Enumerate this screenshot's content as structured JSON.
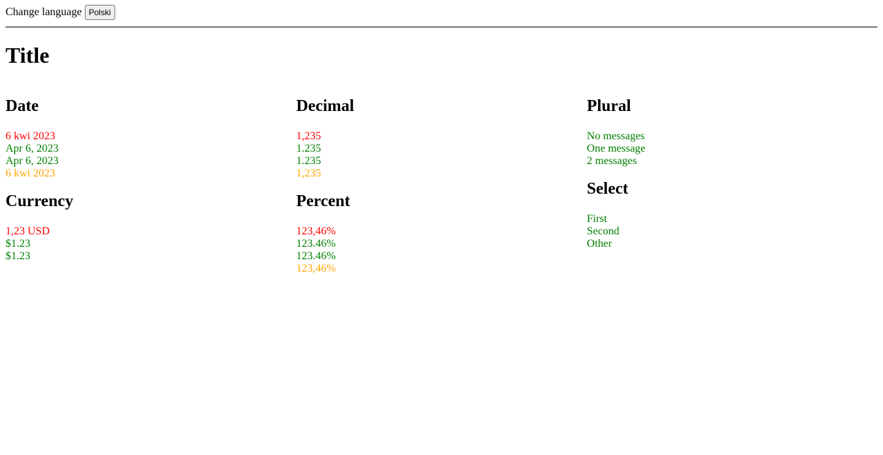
{
  "header": {
    "change_language_label": "Change language",
    "language_button_label": "Polski"
  },
  "page_title": "Title",
  "colors": {
    "red": "#ff0000",
    "green": "#008000",
    "orange": "#ffa500"
  },
  "sections": {
    "date": {
      "title": "Date",
      "values": [
        "6 kwi 2023",
        "Apr 6, 2023",
        "Apr 6, 2023",
        "6 kwi 2023"
      ],
      "colors": [
        "red",
        "green",
        "green",
        "orange"
      ]
    },
    "currency": {
      "title": "Currency",
      "values": [
        "1,23 USD",
        "$1.23",
        "$1.23"
      ],
      "colors": [
        "red",
        "green",
        "green"
      ]
    },
    "decimal": {
      "title": "Decimal",
      "values": [
        "1,235",
        "1.235",
        "1.235",
        "1,235"
      ],
      "colors": [
        "red",
        "green",
        "green",
        "orange"
      ]
    },
    "percent": {
      "title": "Percent",
      "values": [
        "123,46%",
        "123.46%",
        "123.46%",
        "123,46%"
      ],
      "colors": [
        "red",
        "green",
        "green",
        "orange"
      ]
    },
    "plural": {
      "title": "Plural",
      "values": [
        "No messages",
        "One message",
        "2 messages"
      ],
      "colors": [
        "green",
        "green",
        "green"
      ]
    },
    "select": {
      "title": "Select",
      "values": [
        "First",
        "Second",
        "Other"
      ],
      "colors": [
        "green",
        "green",
        "green"
      ]
    }
  }
}
